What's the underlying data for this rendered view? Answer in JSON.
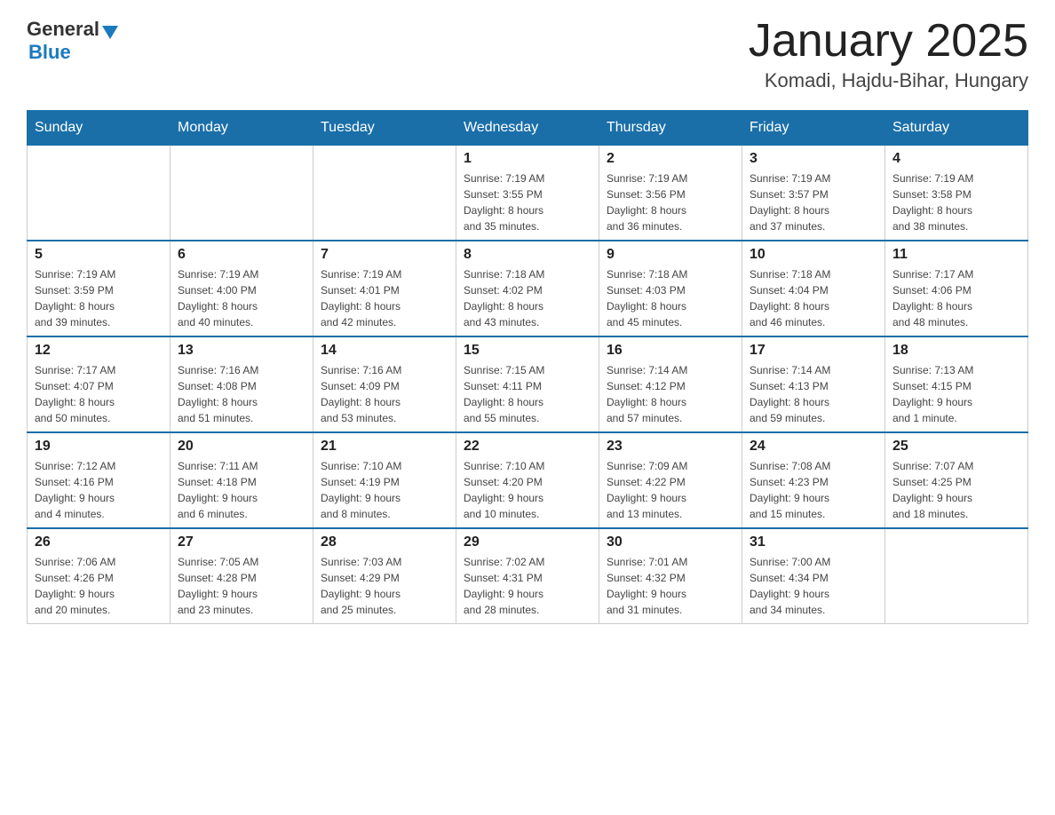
{
  "logo": {
    "general": "General",
    "blue": "Blue"
  },
  "header": {
    "month": "January 2025",
    "location": "Komadi, Hajdu-Bihar, Hungary"
  },
  "weekdays": [
    "Sunday",
    "Monday",
    "Tuesday",
    "Wednesday",
    "Thursday",
    "Friday",
    "Saturday"
  ],
  "weeks": [
    [
      {
        "day": "",
        "info": ""
      },
      {
        "day": "",
        "info": ""
      },
      {
        "day": "",
        "info": ""
      },
      {
        "day": "1",
        "info": "Sunrise: 7:19 AM\nSunset: 3:55 PM\nDaylight: 8 hours\nand 35 minutes."
      },
      {
        "day": "2",
        "info": "Sunrise: 7:19 AM\nSunset: 3:56 PM\nDaylight: 8 hours\nand 36 minutes."
      },
      {
        "day": "3",
        "info": "Sunrise: 7:19 AM\nSunset: 3:57 PM\nDaylight: 8 hours\nand 37 minutes."
      },
      {
        "day": "4",
        "info": "Sunrise: 7:19 AM\nSunset: 3:58 PM\nDaylight: 8 hours\nand 38 minutes."
      }
    ],
    [
      {
        "day": "5",
        "info": "Sunrise: 7:19 AM\nSunset: 3:59 PM\nDaylight: 8 hours\nand 39 minutes."
      },
      {
        "day": "6",
        "info": "Sunrise: 7:19 AM\nSunset: 4:00 PM\nDaylight: 8 hours\nand 40 minutes."
      },
      {
        "day": "7",
        "info": "Sunrise: 7:19 AM\nSunset: 4:01 PM\nDaylight: 8 hours\nand 42 minutes."
      },
      {
        "day": "8",
        "info": "Sunrise: 7:18 AM\nSunset: 4:02 PM\nDaylight: 8 hours\nand 43 minutes."
      },
      {
        "day": "9",
        "info": "Sunrise: 7:18 AM\nSunset: 4:03 PM\nDaylight: 8 hours\nand 45 minutes."
      },
      {
        "day": "10",
        "info": "Sunrise: 7:18 AM\nSunset: 4:04 PM\nDaylight: 8 hours\nand 46 minutes."
      },
      {
        "day": "11",
        "info": "Sunrise: 7:17 AM\nSunset: 4:06 PM\nDaylight: 8 hours\nand 48 minutes."
      }
    ],
    [
      {
        "day": "12",
        "info": "Sunrise: 7:17 AM\nSunset: 4:07 PM\nDaylight: 8 hours\nand 50 minutes."
      },
      {
        "day": "13",
        "info": "Sunrise: 7:16 AM\nSunset: 4:08 PM\nDaylight: 8 hours\nand 51 minutes."
      },
      {
        "day": "14",
        "info": "Sunrise: 7:16 AM\nSunset: 4:09 PM\nDaylight: 8 hours\nand 53 minutes."
      },
      {
        "day": "15",
        "info": "Sunrise: 7:15 AM\nSunset: 4:11 PM\nDaylight: 8 hours\nand 55 minutes."
      },
      {
        "day": "16",
        "info": "Sunrise: 7:14 AM\nSunset: 4:12 PM\nDaylight: 8 hours\nand 57 minutes."
      },
      {
        "day": "17",
        "info": "Sunrise: 7:14 AM\nSunset: 4:13 PM\nDaylight: 8 hours\nand 59 minutes."
      },
      {
        "day": "18",
        "info": "Sunrise: 7:13 AM\nSunset: 4:15 PM\nDaylight: 9 hours\nand 1 minute."
      }
    ],
    [
      {
        "day": "19",
        "info": "Sunrise: 7:12 AM\nSunset: 4:16 PM\nDaylight: 9 hours\nand 4 minutes."
      },
      {
        "day": "20",
        "info": "Sunrise: 7:11 AM\nSunset: 4:18 PM\nDaylight: 9 hours\nand 6 minutes."
      },
      {
        "day": "21",
        "info": "Sunrise: 7:10 AM\nSunset: 4:19 PM\nDaylight: 9 hours\nand 8 minutes."
      },
      {
        "day": "22",
        "info": "Sunrise: 7:10 AM\nSunset: 4:20 PM\nDaylight: 9 hours\nand 10 minutes."
      },
      {
        "day": "23",
        "info": "Sunrise: 7:09 AM\nSunset: 4:22 PM\nDaylight: 9 hours\nand 13 minutes."
      },
      {
        "day": "24",
        "info": "Sunrise: 7:08 AM\nSunset: 4:23 PM\nDaylight: 9 hours\nand 15 minutes."
      },
      {
        "day": "25",
        "info": "Sunrise: 7:07 AM\nSunset: 4:25 PM\nDaylight: 9 hours\nand 18 minutes."
      }
    ],
    [
      {
        "day": "26",
        "info": "Sunrise: 7:06 AM\nSunset: 4:26 PM\nDaylight: 9 hours\nand 20 minutes."
      },
      {
        "day": "27",
        "info": "Sunrise: 7:05 AM\nSunset: 4:28 PM\nDaylight: 9 hours\nand 23 minutes."
      },
      {
        "day": "28",
        "info": "Sunrise: 7:03 AM\nSunset: 4:29 PM\nDaylight: 9 hours\nand 25 minutes."
      },
      {
        "day": "29",
        "info": "Sunrise: 7:02 AM\nSunset: 4:31 PM\nDaylight: 9 hours\nand 28 minutes."
      },
      {
        "day": "30",
        "info": "Sunrise: 7:01 AM\nSunset: 4:32 PM\nDaylight: 9 hours\nand 31 minutes."
      },
      {
        "day": "31",
        "info": "Sunrise: 7:00 AM\nSunset: 4:34 PM\nDaylight: 9 hours\nand 34 minutes."
      },
      {
        "day": "",
        "info": ""
      }
    ]
  ]
}
